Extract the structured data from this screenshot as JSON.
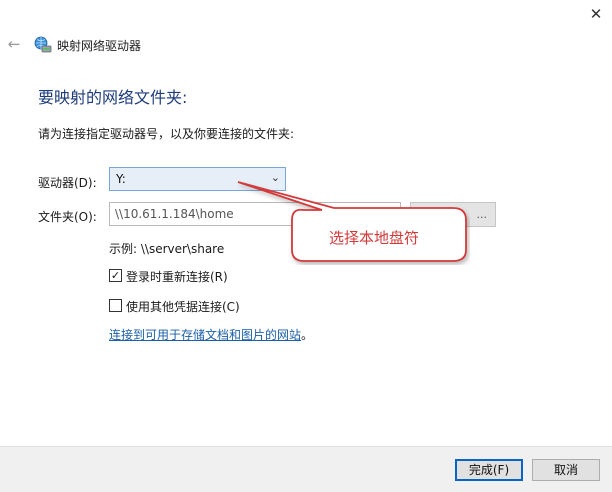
{
  "window": {
    "title": "映射网络驱动器",
    "close_glyph": "✕",
    "back_glyph": "←"
  },
  "icons": {
    "app": "network-drive-icon",
    "back": "back-arrow-icon",
    "close": "close-icon",
    "dropdown": "chevron-down-icon"
  },
  "main": {
    "heading": "要映射的网络文件夹:",
    "instruction": "请为连接指定驱动器号，以及你要连接的文件夹:"
  },
  "drive": {
    "label": "驱动器(D):",
    "value": "Y:",
    "chevron": "⌄"
  },
  "folder": {
    "label": "文件夹(O):",
    "value": "\\\\10.61.1.184\\home",
    "browse_label": "..."
  },
  "example": "示例: \\\\server\\share",
  "options": {
    "reconnect": {
      "label": "登录时重新连接(R)",
      "checked": true,
      "mark": "✓"
    },
    "other_credentials": {
      "label": "使用其他凭据连接(C)",
      "checked": false,
      "mark": ""
    }
  },
  "link": {
    "text": "连接到可用于存储文档和图片的网站",
    "suffix": "。"
  },
  "footer": {
    "finish_label": "完成(F)",
    "cancel_label": "取消"
  },
  "annotation": {
    "text": "选择本地盘符",
    "color": "#d23a3a"
  },
  "colors": {
    "heading": "#1e3c7a",
    "link": "#1b5fa8",
    "select_border": "#7aa7d6",
    "select_bg": "#e6eef8",
    "primary_border": "#0a64c8"
  }
}
